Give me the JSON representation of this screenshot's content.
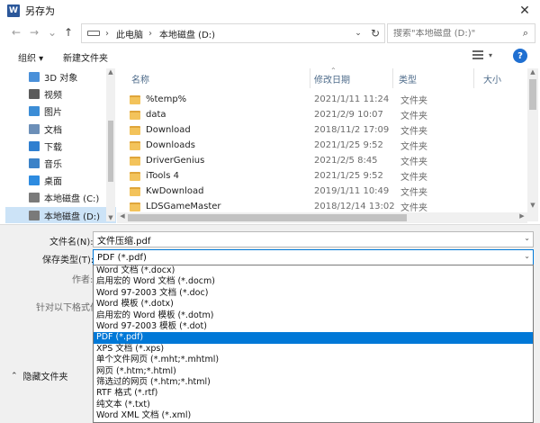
{
  "window": {
    "title": "另存为",
    "app_badge": "W",
    "close_glyph": "✕"
  },
  "nav": {
    "back_glyph": "←",
    "forward_glyph": "→",
    "recent_glyph": "⌄",
    "up_glyph": "↑",
    "address": {
      "sep": "›",
      "seg1": "此电脑",
      "seg2": "本地磁盘 (D:)",
      "dropdown_glyph": "⌄",
      "refresh_glyph": "↻"
    },
    "search": {
      "placeholder": "搜索\"本地磁盘 (D:)\"",
      "icon_glyph": "⌕"
    }
  },
  "toolbar": {
    "organize": "组织 ▾",
    "new_folder": "新建文件夹",
    "view_caret": "▾",
    "help": "?"
  },
  "sidebar": {
    "items": [
      {
        "label": "3D 对象",
        "color": "#4a90d9"
      },
      {
        "label": "视频",
        "color": "#5b5b5b"
      },
      {
        "label": "图片",
        "color": "#3c8dd6"
      },
      {
        "label": "文档",
        "color": "#6c8fb8"
      },
      {
        "label": "下载",
        "color": "#2f7fd0"
      },
      {
        "label": "音乐",
        "color": "#3b82c8"
      },
      {
        "label": "桌面",
        "color": "#2d8be0"
      },
      {
        "label": "本地磁盘 (C:)",
        "color": "#7a7a7a"
      },
      {
        "label": "本地磁盘 (D:)",
        "color": "#7a7a7a"
      }
    ],
    "selected_index": 8
  },
  "file_list": {
    "columns": {
      "name": "名称",
      "date": "修改日期",
      "type": "类型",
      "size": "大小"
    },
    "sort_glyph": "⌃",
    "rows": [
      {
        "name": "%temp%",
        "date": "2021/1/11 11:24",
        "type": "文件夹"
      },
      {
        "name": "data",
        "date": "2021/2/9 10:07",
        "type": "文件夹"
      },
      {
        "name": "Download",
        "date": "2018/11/2 17:09",
        "type": "文件夹"
      },
      {
        "name": "Downloads",
        "date": "2021/1/25 9:52",
        "type": "文件夹"
      },
      {
        "name": "DriverGenius",
        "date": "2021/2/5 8:45",
        "type": "文件夹"
      },
      {
        "name": "iTools 4",
        "date": "2021/1/25 9:52",
        "type": "文件夹"
      },
      {
        "name": "KwDownload",
        "date": "2019/1/11 10:49",
        "type": "文件夹"
      },
      {
        "name": "LDSGameMaster",
        "date": "2018/12/14 13:02",
        "type": "文件夹"
      }
    ]
  },
  "form": {
    "filename_label": "文件名(N):",
    "filename_value": "文件压缩.pdf",
    "filetype_label": "保存类型(T):",
    "filetype_value": "PDF (*.pdf)",
    "author_label": "作者:",
    "optimize_label": "针对以下格式优",
    "dropdown_glyph": "⌄"
  },
  "filetype_options": [
    "Word 文档 (*.docx)",
    "启用宏的 Word 文档 (*.docm)",
    "Word 97-2003 文档 (*.doc)",
    "Word 模板 (*.dotx)",
    "启用宏的 Word 模板 (*.dotm)",
    "Word 97-2003 模板 (*.dot)",
    "PDF (*.pdf)",
    "XPS 文档 (*.xps)",
    "单个文件网页 (*.mht;*.mhtml)",
    "网页 (*.htm;*.html)",
    "筛选过的网页 (*.htm;*.html)",
    "RTF 格式 (*.rtf)",
    "纯文本 (*.txt)",
    "Word XML 文档 (*.xml)"
  ],
  "selected_option_index": 6,
  "hide_folders": {
    "glyph": "⌃",
    "label": "隐藏文件夹"
  },
  "colors": {
    "accent": "#0078d7",
    "selection_light": "#cce3f7",
    "folder": "#f3c35b",
    "header_text": "#4d6b8a"
  }
}
